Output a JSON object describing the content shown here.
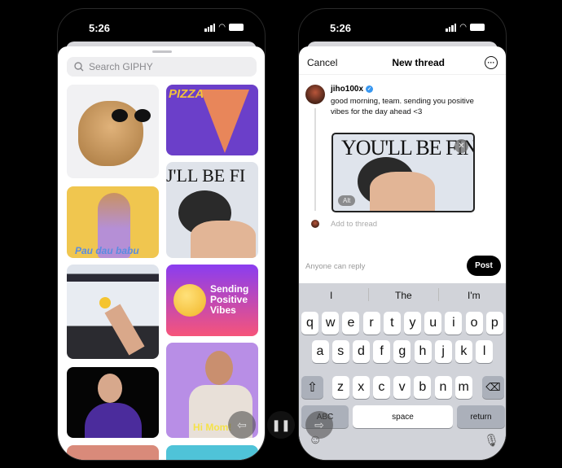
{
  "left_phone": {
    "status": {
      "time": "5:26"
    },
    "search": {
      "placeholder": "Search GIPHY",
      "icon": "search-icon"
    },
    "gifs": [
      {
        "caption": ""
      },
      {
        "caption": "PIZZA"
      },
      {
        "caption": "Pau dau babu"
      },
      {
        "caption": "J'LL BE FI"
      },
      {
        "caption": ""
      },
      {
        "caption": "Sending Positive Vibes"
      },
      {
        "caption": ""
      },
      {
        "caption": "Hi Mom!"
      }
    ]
  },
  "right_phone": {
    "status": {
      "time": "5:26"
    },
    "header": {
      "cancel": "Cancel",
      "title": "New thread",
      "more_icon": "more-icon"
    },
    "post": {
      "username": "jiho100x",
      "verified": true,
      "text": "good morning, team. sending you positive vibes for the day ahead <3",
      "gif_caption": "YOU'LL BE FINE",
      "alt": "Alt"
    },
    "add_to_thread": "Add to thread",
    "reply_setting": "Anyone can reply",
    "post_button": "Post",
    "keyboard": {
      "suggestions": [
        "I",
        "The",
        "I'm"
      ],
      "row1": [
        "q",
        "w",
        "e",
        "r",
        "t",
        "y",
        "u",
        "i",
        "o",
        "p"
      ],
      "row2": [
        "a",
        "s",
        "d",
        "f",
        "g",
        "h",
        "j",
        "k",
        "l"
      ],
      "row3": [
        "z",
        "x",
        "c",
        "v",
        "b",
        "n",
        "m"
      ],
      "abc": "ABC",
      "space": "space",
      "return": "return"
    }
  },
  "media_controls": {
    "back": "back-icon",
    "pause": "pause-icon",
    "forward": "forward-icon"
  },
  "colors": {
    "verified": "#3897f0",
    "post_button": "#000000",
    "keyboard_bg": "#d1d3d9"
  }
}
